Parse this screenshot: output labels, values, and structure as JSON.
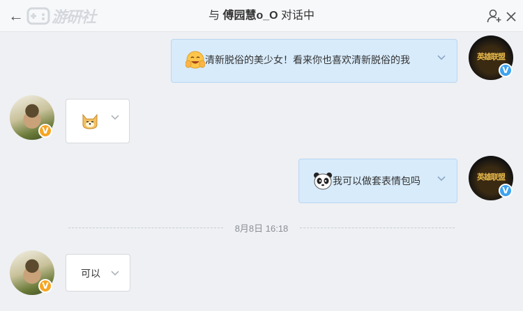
{
  "header": {
    "back_icon": "back-arrow-icon",
    "watermark_text": "游研社",
    "title_prefix": "与",
    "contact_name": "傅园慧o_O",
    "title_suffix": "对话中",
    "add_user_icon": "add-user-icon",
    "close_icon": "close-icon"
  },
  "messages": [
    {
      "side": "right",
      "emoji": "laughing-face-emoji",
      "text": "清新脱俗的美少女！看来你也喜欢清新脱俗的我",
      "verified_badge": "V"
    },
    {
      "side": "left",
      "emoji": "doge-face-emoji",
      "text": "",
      "verified_badge": "V"
    },
    {
      "side": "right",
      "emoji": "panda-face-emoji",
      "text": "我可以做套表情包吗",
      "verified_badge": "V"
    },
    {
      "side": "left",
      "emoji": "",
      "text": "可以",
      "verified_badge": "V"
    }
  ],
  "timestamp": "8月8日 16:18",
  "avatar_game": {
    "logo_text": "英雄联盟"
  },
  "colors": {
    "right_bubble": "#d8ebfb",
    "left_bubble": "#ffffff",
    "user_badge": "#f6a623",
    "official_badge": "#3fa3ee"
  }
}
